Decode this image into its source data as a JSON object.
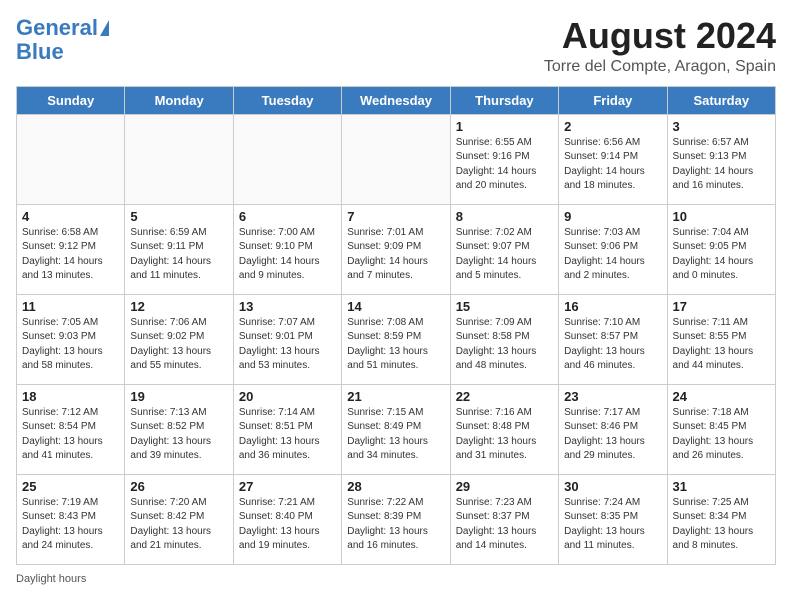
{
  "header": {
    "logo_line1": "General",
    "logo_line2": "Blue",
    "main_title": "August 2024",
    "subtitle": "Torre del Compte, Aragon, Spain"
  },
  "days_of_week": [
    "Sunday",
    "Monday",
    "Tuesday",
    "Wednesday",
    "Thursday",
    "Friday",
    "Saturday"
  ],
  "weeks": [
    [
      {
        "day": "",
        "info": ""
      },
      {
        "day": "",
        "info": ""
      },
      {
        "day": "",
        "info": ""
      },
      {
        "day": "",
        "info": ""
      },
      {
        "day": "1",
        "info": "Sunrise: 6:55 AM\nSunset: 9:16 PM\nDaylight: 14 hours\nand 20 minutes."
      },
      {
        "day": "2",
        "info": "Sunrise: 6:56 AM\nSunset: 9:14 PM\nDaylight: 14 hours\nand 18 minutes."
      },
      {
        "day": "3",
        "info": "Sunrise: 6:57 AM\nSunset: 9:13 PM\nDaylight: 14 hours\nand 16 minutes."
      }
    ],
    [
      {
        "day": "4",
        "info": "Sunrise: 6:58 AM\nSunset: 9:12 PM\nDaylight: 14 hours\nand 13 minutes."
      },
      {
        "day": "5",
        "info": "Sunrise: 6:59 AM\nSunset: 9:11 PM\nDaylight: 14 hours\nand 11 minutes."
      },
      {
        "day": "6",
        "info": "Sunrise: 7:00 AM\nSunset: 9:10 PM\nDaylight: 14 hours\nand 9 minutes."
      },
      {
        "day": "7",
        "info": "Sunrise: 7:01 AM\nSunset: 9:09 PM\nDaylight: 14 hours\nand 7 minutes."
      },
      {
        "day": "8",
        "info": "Sunrise: 7:02 AM\nSunset: 9:07 PM\nDaylight: 14 hours\nand 5 minutes."
      },
      {
        "day": "9",
        "info": "Sunrise: 7:03 AM\nSunset: 9:06 PM\nDaylight: 14 hours\nand 2 minutes."
      },
      {
        "day": "10",
        "info": "Sunrise: 7:04 AM\nSunset: 9:05 PM\nDaylight: 14 hours\nand 0 minutes."
      }
    ],
    [
      {
        "day": "11",
        "info": "Sunrise: 7:05 AM\nSunset: 9:03 PM\nDaylight: 13 hours\nand 58 minutes."
      },
      {
        "day": "12",
        "info": "Sunrise: 7:06 AM\nSunset: 9:02 PM\nDaylight: 13 hours\nand 55 minutes."
      },
      {
        "day": "13",
        "info": "Sunrise: 7:07 AM\nSunset: 9:01 PM\nDaylight: 13 hours\nand 53 minutes."
      },
      {
        "day": "14",
        "info": "Sunrise: 7:08 AM\nSunset: 8:59 PM\nDaylight: 13 hours\nand 51 minutes."
      },
      {
        "day": "15",
        "info": "Sunrise: 7:09 AM\nSunset: 8:58 PM\nDaylight: 13 hours\nand 48 minutes."
      },
      {
        "day": "16",
        "info": "Sunrise: 7:10 AM\nSunset: 8:57 PM\nDaylight: 13 hours\nand 46 minutes."
      },
      {
        "day": "17",
        "info": "Sunrise: 7:11 AM\nSunset: 8:55 PM\nDaylight: 13 hours\nand 44 minutes."
      }
    ],
    [
      {
        "day": "18",
        "info": "Sunrise: 7:12 AM\nSunset: 8:54 PM\nDaylight: 13 hours\nand 41 minutes."
      },
      {
        "day": "19",
        "info": "Sunrise: 7:13 AM\nSunset: 8:52 PM\nDaylight: 13 hours\nand 39 minutes."
      },
      {
        "day": "20",
        "info": "Sunrise: 7:14 AM\nSunset: 8:51 PM\nDaylight: 13 hours\nand 36 minutes."
      },
      {
        "day": "21",
        "info": "Sunrise: 7:15 AM\nSunset: 8:49 PM\nDaylight: 13 hours\nand 34 minutes."
      },
      {
        "day": "22",
        "info": "Sunrise: 7:16 AM\nSunset: 8:48 PM\nDaylight: 13 hours\nand 31 minutes."
      },
      {
        "day": "23",
        "info": "Sunrise: 7:17 AM\nSunset: 8:46 PM\nDaylight: 13 hours\nand 29 minutes."
      },
      {
        "day": "24",
        "info": "Sunrise: 7:18 AM\nSunset: 8:45 PM\nDaylight: 13 hours\nand 26 minutes."
      }
    ],
    [
      {
        "day": "25",
        "info": "Sunrise: 7:19 AM\nSunset: 8:43 PM\nDaylight: 13 hours\nand 24 minutes."
      },
      {
        "day": "26",
        "info": "Sunrise: 7:20 AM\nSunset: 8:42 PM\nDaylight: 13 hours\nand 21 minutes."
      },
      {
        "day": "27",
        "info": "Sunrise: 7:21 AM\nSunset: 8:40 PM\nDaylight: 13 hours\nand 19 minutes."
      },
      {
        "day": "28",
        "info": "Sunrise: 7:22 AM\nSunset: 8:39 PM\nDaylight: 13 hours\nand 16 minutes."
      },
      {
        "day": "29",
        "info": "Sunrise: 7:23 AM\nSunset: 8:37 PM\nDaylight: 13 hours\nand 14 minutes."
      },
      {
        "day": "30",
        "info": "Sunrise: 7:24 AM\nSunset: 8:35 PM\nDaylight: 13 hours\nand 11 minutes."
      },
      {
        "day": "31",
        "info": "Sunrise: 7:25 AM\nSunset: 8:34 PM\nDaylight: 13 hours\nand 8 minutes."
      }
    ]
  ],
  "footer": {
    "daylight_label": "Daylight hours"
  }
}
